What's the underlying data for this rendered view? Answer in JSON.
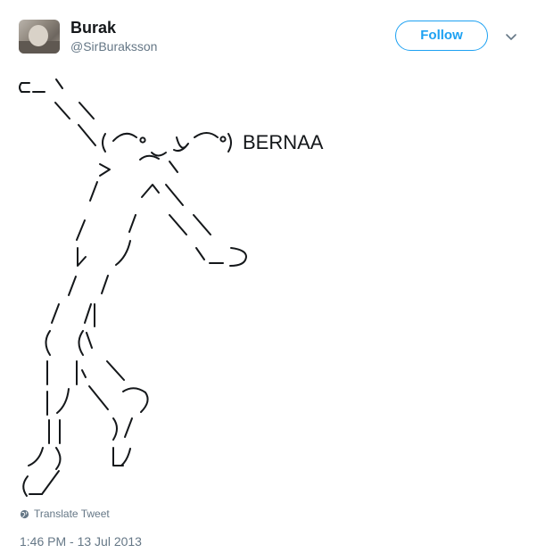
{
  "user": {
    "name": "Burak",
    "handle": "@SirBuraksson"
  },
  "follow_button": {
    "label": "Follow"
  },
  "tweet": {
    "text_suffix": "BERNAA",
    "art_face": "(͡° ͜ʖ ͡°)",
    "art_lines": [
      "⊂_ヽ",
      "　 ＼＼",
      "　　 ＼( ͡° ͜ʖ ͡°)",
      "　　　 >　⌒ヽ",
      "　　　/ 　 へ＼",
      "　　 /　　/　＼＼",
      "　　 ﾚ　ノ　　 ヽ_つ",
      "　　/　/",
      "　 /　/|",
      "　(　(ヽ",
      "　|　|、＼",
      "　| 丿 ＼ ⌒)",
      "　| |　　) /",
      "ノ )　　Lﾉ",
      "(_／"
    ]
  },
  "actions": {
    "translate_label": "Translate Tweet"
  },
  "meta": {
    "timestamp": "1:46 PM - 13 Jul 2013"
  },
  "colors": {
    "accent": "#1da1f2",
    "secondary_text": "#657786",
    "primary_text": "#14171a"
  },
  "icons": {
    "translate": "globe-icon",
    "menu": "chevron-down-icon"
  }
}
